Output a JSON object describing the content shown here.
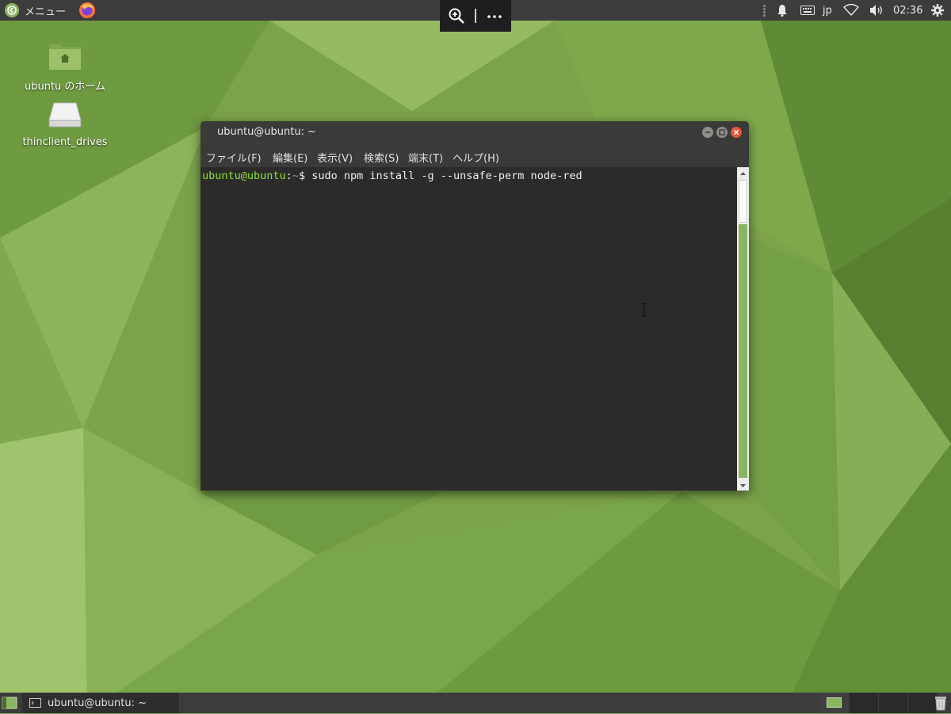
{
  "top_panel": {
    "menu_label": "メニュー",
    "menu_icon": "ubuntu-mate-menu-icon",
    "browser_icon": "firefox-icon",
    "tray": {
      "notification_icon": "bell-icon",
      "keyboard_icon": "keyboard-icon",
      "input_language": "jp",
      "network_icon": "wifi-icon",
      "volume_icon": "volume-icon",
      "clock": "02:36",
      "settings_icon": "gear-icon"
    }
  },
  "remote_toolbar": {
    "zoom_icon": "zoom-in-icon",
    "more_icon": "more-options-icon"
  },
  "desktop": {
    "icons": [
      {
        "label": "ubuntu のホーム",
        "icon": "home-folder-icon"
      },
      {
        "label": "thinclient_drives",
        "icon": "drive-icon"
      }
    ]
  },
  "terminal": {
    "title": "ubuntu@ubuntu: ~",
    "menu": [
      "ファイル(F)",
      "編集(E)",
      "表示(V)",
      "検索(S)",
      "端末(T)",
      "ヘルプ(H)"
    ],
    "prompt_user": "ubuntu@ubuntu",
    "prompt_sep": ":",
    "prompt_path": "~",
    "prompt_symbol": "$ ",
    "command": "sudo npm install -g --unsafe-perm node-red"
  },
  "bottom_panel": {
    "task_label": "ubuntu@ubuntu: ~",
    "task_icon": "terminal-icon",
    "trash_icon": "trash-icon",
    "accent_color": "#8ab561"
  }
}
